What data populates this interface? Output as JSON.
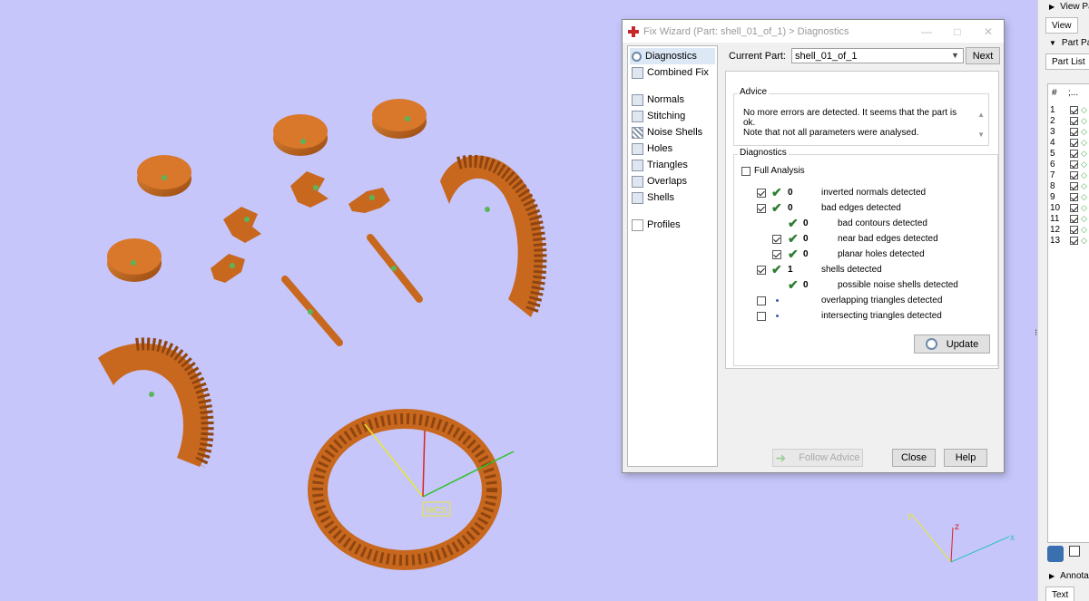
{
  "dialog": {
    "title": "Fix Wizard (Part: shell_01_of_1) > Diagnostics",
    "window_buttons": [
      "—",
      "□",
      "✕"
    ],
    "nav": {
      "items": [
        {
          "label": "Diagnostics",
          "icon": "magnifier-icon",
          "selected": true
        },
        {
          "label": "Combined Fix",
          "icon": "cube-icon"
        },
        {
          "label": "Normals",
          "icon": "normals-icon"
        },
        {
          "label": "Stitching",
          "icon": "stitching-icon"
        },
        {
          "label": "Noise Shells",
          "icon": "noise-shells-icon"
        },
        {
          "label": "Holes",
          "icon": "holes-icon"
        },
        {
          "label": "Triangles",
          "icon": "triangles-icon"
        },
        {
          "label": "Overlaps",
          "icon": "overlaps-icon"
        },
        {
          "label": "Shells",
          "icon": "shells-icon"
        },
        {
          "label": "Profiles",
          "icon": "profiles-icon"
        }
      ]
    },
    "current_part_label": "Current Part:",
    "current_part_value": "shell_01_of_1",
    "next_label": "Next",
    "advice": {
      "title": "Advice",
      "line1": "No more errors are detected. It seems that the part is ok.",
      "line2": "Note that not all parameters were analysed."
    },
    "diagnostics": {
      "title": "Diagnostics",
      "full_analysis_label": "Full Analysis",
      "rows": [
        {
          "count": "0",
          "label": "inverted normals detected",
          "checked": true
        },
        {
          "count": "0",
          "label": "bad edges detected",
          "checked": true
        },
        {
          "count": "0",
          "label": "bad contours detected"
        },
        {
          "count": "0",
          "label": "near bad edges detected",
          "checked": true
        },
        {
          "count": "0",
          "label": "planar holes detected",
          "checked": true
        },
        {
          "count": "1",
          "label": "shells detected",
          "checked": true
        },
        {
          "count": "0",
          "label": "possible noise shells detected"
        },
        {
          "label": "overlapping triangles detected",
          "checked": false
        },
        {
          "label": "intersecting triangles detected",
          "checked": false
        }
      ],
      "update_label": "Update"
    },
    "follow_advice_label": "Follow Advice",
    "close_label": "Close",
    "help_label": "Help"
  },
  "viewport": {
    "wcs_label": "WCS",
    "axis_x": "x",
    "axis_y": "y",
    "axis_z": "z",
    "model_color": "#c8681e"
  },
  "right_panel": {
    "view_header": "View Pa",
    "view_tab": "View",
    "part_header": "Part Pa",
    "part_list_tab": "Part List",
    "col_num": "#",
    "col_vis": ";...",
    "rows": [
      "1",
      "2",
      "3",
      "4",
      "5",
      "6",
      "7",
      "8",
      "9",
      "10",
      "11",
      "12",
      "13"
    ],
    "annot_header": "Annota",
    "text_tab": "Text"
  }
}
